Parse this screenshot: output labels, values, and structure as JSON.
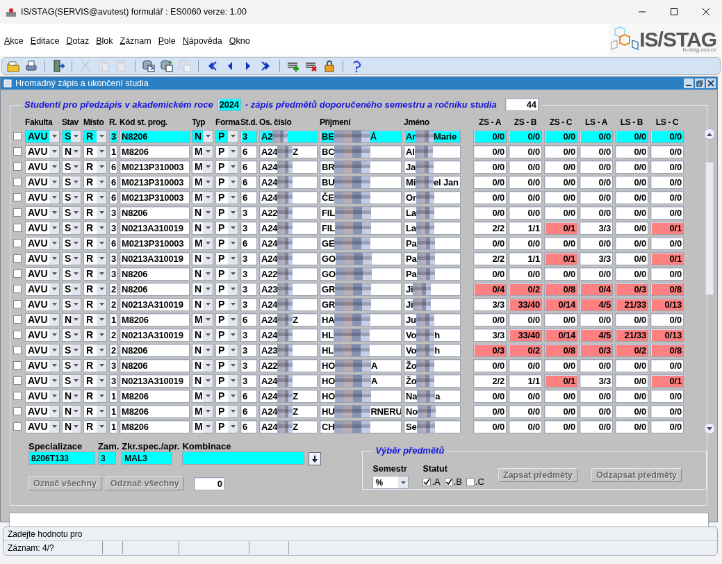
{
  "window": {
    "title": "IS/STAG(SERVIS@avutest) formulář : ES0060 verze: 1.00"
  },
  "menu": [
    "Akce",
    "Editace",
    "Dotaz",
    "Blok",
    "Záznam",
    "Pole",
    "Nápověda",
    "Okno"
  ],
  "logo": {
    "name": "IS/STAG",
    "url": "is-stag.zcu.cz"
  },
  "toolbar": [
    {
      "kind": "save",
      "disabled": false
    },
    {
      "kind": "print",
      "disabled": false
    },
    {
      "kind": "sep"
    },
    {
      "kind": "exit",
      "disabled": false
    },
    {
      "kind": "sep"
    },
    {
      "kind": "cut",
      "disabled": true
    },
    {
      "kind": "copy",
      "disabled": true
    },
    {
      "kind": "paste",
      "disabled": true
    },
    {
      "kind": "sep"
    },
    {
      "kind": "query",
      "disabled": false
    },
    {
      "kind": "query-run",
      "disabled": false
    },
    {
      "kind": "query-cancel",
      "disabled": true
    },
    {
      "kind": "sep"
    },
    {
      "kind": "first",
      "disabled": false
    },
    {
      "kind": "prev",
      "disabled": false
    },
    {
      "kind": "next",
      "disabled": false
    },
    {
      "kind": "last",
      "disabled": false
    },
    {
      "kind": "sep"
    },
    {
      "kind": "insert",
      "disabled": false
    },
    {
      "kind": "delete",
      "disabled": false
    },
    {
      "kind": "lock",
      "disabled": false
    },
    {
      "kind": "sep"
    },
    {
      "kind": "help",
      "disabled": false
    }
  ],
  "form": {
    "title": "Hromadný zápis a ukončení studia"
  },
  "header": {
    "lead": "Studenti pro předzápis v akademickém roce",
    "year": "2024",
    "trail": "- zápis předmětů doporučeného semestru a ročníku studia",
    "count": "44"
  },
  "table": {
    "columns": [
      "Fakulta",
      "Stav",
      "Místo",
      "R.",
      "Kód st. prog.",
      "Typ",
      "Forma",
      "St.d.",
      "Os. číslo",
      "Příjmení",
      "Jméno"
    ],
    "score_columns": [
      "ZS - A",
      "ZS - B",
      "ZS - C",
      "LS - A",
      "LS - B",
      "LS - C"
    ],
    "rows": [
      {
        "selected": true,
        "checked": false,
        "fakulta": "AVU",
        "stav": "S",
        "misto": "R",
        "r": "3",
        "kod": "N8206",
        "typ": "N",
        "forma": "P",
        "std": "3",
        "osc": "A2",
        "prijmeni": "BE",
        "prijmeni_end": "Á",
        "jmeno": "Ar",
        "jmeno_end": "Marie",
        "scores": [
          {
            "text": "0/0",
            "alert": false
          },
          {
            "text": "0/0",
            "alert": false
          },
          {
            "text": "0/0",
            "alert": false
          },
          {
            "text": "0/0",
            "alert": false
          },
          {
            "text": "0/0",
            "alert": false
          },
          {
            "text": "0/0",
            "alert": false
          }
        ]
      },
      {
        "selected": false,
        "checked": false,
        "fakulta": "AVU",
        "stav": "N",
        "misto": "R",
        "r": "1",
        "kod": "M8206",
        "typ": "M",
        "forma": "P",
        "std": "6",
        "osc": "A24",
        "osc_end": "Z",
        "prijmeni": "BC",
        "jmeno": "Al",
        "scores": [
          {
            "text": "0/0",
            "alert": false
          },
          {
            "text": "0/0",
            "alert": false
          },
          {
            "text": "0/0",
            "alert": false
          },
          {
            "text": "0/0",
            "alert": false
          },
          {
            "text": "0/0",
            "alert": false
          },
          {
            "text": "0/0",
            "alert": false
          }
        ]
      },
      {
        "selected": false,
        "checked": false,
        "fakulta": "AVU",
        "stav": "S",
        "misto": "R",
        "r": "6",
        "kod": "M0213P310003",
        "typ": "M",
        "forma": "P",
        "std": "6",
        "osc": "A24",
        "prijmeni": "BR",
        "jmeno": "Ja",
        "scores": [
          {
            "text": "0/0",
            "alert": false
          },
          {
            "text": "0/0",
            "alert": false
          },
          {
            "text": "0/0",
            "alert": false
          },
          {
            "text": "0/0",
            "alert": false
          },
          {
            "text": "0/0",
            "alert": false
          },
          {
            "text": "0/0",
            "alert": false
          }
        ]
      },
      {
        "selected": false,
        "checked": false,
        "fakulta": "AVU",
        "stav": "S",
        "misto": "R",
        "r": "6",
        "kod": "M0213P310003",
        "typ": "M",
        "forma": "P",
        "std": "6",
        "osc": "A24",
        "prijmeni": "BU",
        "jmeno": "Mi",
        "jmeno_end": "el Jan",
        "scores": [
          {
            "text": "0/0",
            "alert": false
          },
          {
            "text": "0/0",
            "alert": false
          },
          {
            "text": "0/0",
            "alert": false
          },
          {
            "text": "0/0",
            "alert": false
          },
          {
            "text": "0/0",
            "alert": false
          },
          {
            "text": "0/0",
            "alert": false
          }
        ]
      },
      {
        "selected": false,
        "checked": false,
        "fakulta": "AVU",
        "stav": "S",
        "misto": "R",
        "r": "6",
        "kod": "M0213P310003",
        "typ": "M",
        "forma": "P",
        "std": "6",
        "osc": "A24",
        "prijmeni": "ČE",
        "jmeno": "Or",
        "scores": [
          {
            "text": "0/0",
            "alert": false
          },
          {
            "text": "0/0",
            "alert": false
          },
          {
            "text": "0/0",
            "alert": false
          },
          {
            "text": "0/0",
            "alert": false
          },
          {
            "text": "0/0",
            "alert": false
          },
          {
            "text": "0/0",
            "alert": false
          }
        ]
      },
      {
        "selected": false,
        "checked": false,
        "fakulta": "AVU",
        "stav": "S",
        "misto": "R",
        "r": "3",
        "kod": "N8206",
        "typ": "N",
        "forma": "P",
        "std": "3",
        "osc": "A22",
        "prijmeni": "FIL",
        "jmeno": "La",
        "scores": [
          {
            "text": "0/0",
            "alert": false
          },
          {
            "text": "0/0",
            "alert": false
          },
          {
            "text": "0/0",
            "alert": false
          },
          {
            "text": "0/0",
            "alert": false
          },
          {
            "text": "0/0",
            "alert": false
          },
          {
            "text": "0/0",
            "alert": false
          }
        ]
      },
      {
        "selected": false,
        "checked": false,
        "fakulta": "AVU",
        "stav": "S",
        "misto": "R",
        "r": "3",
        "kod": "N0213A310019",
        "typ": "N",
        "forma": "P",
        "std": "3",
        "osc": "A24",
        "prijmeni": "FIL",
        "jmeno": "La",
        "scores": [
          {
            "text": "2/2",
            "alert": false
          },
          {
            "text": "1/1",
            "alert": false
          },
          {
            "text": "0/1",
            "alert": true
          },
          {
            "text": "3/3",
            "alert": false
          },
          {
            "text": "0/0",
            "alert": false
          },
          {
            "text": "0/1",
            "alert": true
          }
        ]
      },
      {
        "selected": false,
        "checked": false,
        "fakulta": "AVU",
        "stav": "S",
        "misto": "R",
        "r": "6",
        "kod": "M0213P310003",
        "typ": "M",
        "forma": "P",
        "std": "6",
        "osc": "A24",
        "prijmeni": "GE",
        "jmeno": "Pa",
        "scores": [
          {
            "text": "0/0",
            "alert": false
          },
          {
            "text": "0/0",
            "alert": false
          },
          {
            "text": "0/0",
            "alert": false
          },
          {
            "text": "0/0",
            "alert": false
          },
          {
            "text": "0/0",
            "alert": false
          },
          {
            "text": "0/0",
            "alert": false
          }
        ]
      },
      {
        "selected": false,
        "checked": false,
        "fakulta": "AVU",
        "stav": "S",
        "misto": "R",
        "r": "3",
        "kod": "N0213A310019",
        "typ": "N",
        "forma": "P",
        "std": "3",
        "osc": "A24",
        "prijmeni": "GO",
        "jmeno": "Pa",
        "scores": [
          {
            "text": "2/2",
            "alert": false
          },
          {
            "text": "1/1",
            "alert": false
          },
          {
            "text": "0/1",
            "alert": true
          },
          {
            "text": "3/3",
            "alert": false
          },
          {
            "text": "0/0",
            "alert": false
          },
          {
            "text": "0/1",
            "alert": true
          }
        ]
      },
      {
        "selected": false,
        "checked": false,
        "fakulta": "AVU",
        "stav": "S",
        "misto": "R",
        "r": "3",
        "kod": "N8206",
        "typ": "N",
        "forma": "P",
        "std": "3",
        "osc": "A22",
        "prijmeni": "GO",
        "jmeno": "Pa",
        "scores": [
          {
            "text": "0/0",
            "alert": false
          },
          {
            "text": "0/0",
            "alert": false
          },
          {
            "text": "0/0",
            "alert": false
          },
          {
            "text": "0/0",
            "alert": false
          },
          {
            "text": "0/0",
            "alert": false
          },
          {
            "text": "0/0",
            "alert": false
          }
        ]
      },
      {
        "selected": false,
        "checked": false,
        "fakulta": "AVU",
        "stav": "S",
        "misto": "R",
        "r": "2",
        "kod": "N8206",
        "typ": "N",
        "forma": "P",
        "std": "3",
        "osc": "A23",
        "prijmeni": "GR",
        "jmeno": "Ji",
        "scores": [
          {
            "text": "0/4",
            "alert": true
          },
          {
            "text": "0/2",
            "alert": true
          },
          {
            "text": "0/8",
            "alert": true
          },
          {
            "text": "0/4",
            "alert": true
          },
          {
            "text": "0/3",
            "alert": true
          },
          {
            "text": "0/8",
            "alert": true
          }
        ]
      },
      {
        "selected": false,
        "checked": false,
        "fakulta": "AVU",
        "stav": "S",
        "misto": "R",
        "r": "2",
        "kod": "N0213A310019",
        "typ": "N",
        "forma": "P",
        "std": "3",
        "osc": "A24",
        "prijmeni": "GR",
        "jmeno": "Ji",
        "scores": [
          {
            "text": "3/3",
            "alert": false
          },
          {
            "text": "33/40",
            "alert": true
          },
          {
            "text": "0/14",
            "alert": true
          },
          {
            "text": "4/5",
            "alert": true
          },
          {
            "text": "21/33",
            "alert": true
          },
          {
            "text": "0/13",
            "alert": true
          }
        ]
      },
      {
        "selected": false,
        "checked": false,
        "fakulta": "AVU",
        "stav": "N",
        "misto": "R",
        "r": "1",
        "kod": "M8206",
        "typ": "M",
        "forma": "P",
        "std": "6",
        "osc": "A24",
        "osc_end": "Z",
        "prijmeni": "HA",
        "jmeno": "Ju",
        "scores": [
          {
            "text": "0/0",
            "alert": false
          },
          {
            "text": "0/0",
            "alert": false
          },
          {
            "text": "0/0",
            "alert": false
          },
          {
            "text": "0/0",
            "alert": false
          },
          {
            "text": "0/0",
            "alert": false
          },
          {
            "text": "0/0",
            "alert": false
          }
        ]
      },
      {
        "selected": false,
        "checked": false,
        "fakulta": "AVU",
        "stav": "S",
        "misto": "R",
        "r": "2",
        "kod": "N0213A310019",
        "typ": "N",
        "forma": "P",
        "std": "3",
        "osc": "A24",
        "prijmeni": "HL",
        "jmeno": "Vo",
        "jmeno_end": "h",
        "scores": [
          {
            "text": "3/3",
            "alert": false
          },
          {
            "text": "33/40",
            "alert": true
          },
          {
            "text": "0/14",
            "alert": true
          },
          {
            "text": "4/5",
            "alert": true
          },
          {
            "text": "21/33",
            "alert": true
          },
          {
            "text": "0/13",
            "alert": true
          }
        ]
      },
      {
        "selected": false,
        "checked": false,
        "fakulta": "AVU",
        "stav": "S",
        "misto": "R",
        "r": "2",
        "kod": "N8206",
        "typ": "N",
        "forma": "P",
        "std": "3",
        "osc": "A23",
        "prijmeni": "HL",
        "jmeno": "Vo",
        "jmeno_end": "h",
        "scores": [
          {
            "text": "0/3",
            "alert": true
          },
          {
            "text": "0/2",
            "alert": true
          },
          {
            "text": "0/8",
            "alert": true
          },
          {
            "text": "0/3",
            "alert": true
          },
          {
            "text": "0/2",
            "alert": true
          },
          {
            "text": "0/8",
            "alert": true
          }
        ]
      },
      {
        "selected": false,
        "checked": false,
        "fakulta": "AVU",
        "stav": "S",
        "misto": "R",
        "r": "3",
        "kod": "N8206",
        "typ": "N",
        "forma": "P",
        "std": "3",
        "osc": "A22",
        "prijmeni": "HO",
        "prijmeni_end": "A",
        "jmeno": "Žo",
        "scores": [
          {
            "text": "0/0",
            "alert": false
          },
          {
            "text": "0/0",
            "alert": false
          },
          {
            "text": "0/0",
            "alert": false
          },
          {
            "text": "0/0",
            "alert": false
          },
          {
            "text": "0/0",
            "alert": false
          },
          {
            "text": "0/0",
            "alert": false
          }
        ]
      },
      {
        "selected": false,
        "checked": false,
        "fakulta": "AVU",
        "stav": "S",
        "misto": "R",
        "r": "3",
        "kod": "N0213A310019",
        "typ": "N",
        "forma": "P",
        "std": "3",
        "osc": "A24",
        "prijmeni": "HO",
        "prijmeni_end": "A",
        "jmeno": "Žo",
        "scores": [
          {
            "text": "2/2",
            "alert": false
          },
          {
            "text": "1/1",
            "alert": false
          },
          {
            "text": "0/1",
            "alert": true
          },
          {
            "text": "3/3",
            "alert": false
          },
          {
            "text": "0/0",
            "alert": false
          },
          {
            "text": "0/1",
            "alert": true
          }
        ]
      },
      {
        "selected": false,
        "checked": false,
        "fakulta": "AVU",
        "stav": "N",
        "misto": "R",
        "r": "1",
        "kod": "M8206",
        "typ": "M",
        "forma": "P",
        "std": "6",
        "osc": "A24",
        "osc_end": "Z",
        "prijmeni": "HO",
        "jmeno": "Na",
        "jmeno_end": "a",
        "scores": [
          {
            "text": "0/0",
            "alert": false
          },
          {
            "text": "0/0",
            "alert": false
          },
          {
            "text": "0/0",
            "alert": false
          },
          {
            "text": "0/0",
            "alert": false
          },
          {
            "text": "0/0",
            "alert": false
          },
          {
            "text": "0/0",
            "alert": false
          }
        ]
      },
      {
        "selected": false,
        "checked": false,
        "fakulta": "AVU",
        "stav": "N",
        "misto": "R",
        "r": "1",
        "kod": "M8206",
        "typ": "M",
        "forma": "P",
        "std": "6",
        "osc": "A24",
        "osc_end": "Z",
        "prijmeni": "HU",
        "prijmeni_end": "RNERU",
        "jmeno": "No",
        "scores": [
          {
            "text": "0/0",
            "alert": false
          },
          {
            "text": "0/0",
            "alert": false
          },
          {
            "text": "0/0",
            "alert": false
          },
          {
            "text": "0/0",
            "alert": false
          },
          {
            "text": "0/0",
            "alert": false
          },
          {
            "text": "0/0",
            "alert": false
          }
        ]
      },
      {
        "selected": false,
        "checked": false,
        "fakulta": "AVU",
        "stav": "N",
        "misto": "R",
        "r": "1",
        "kod": "M8206",
        "typ": "M",
        "forma": "P",
        "std": "6",
        "osc": "A24",
        "osc_end": "Z",
        "prijmeni": "CH",
        "jmeno": "Se",
        "scores": [
          {
            "text": "0/0",
            "alert": false
          },
          {
            "text": "0/0",
            "alert": false
          },
          {
            "text": "0/0",
            "alert": false
          },
          {
            "text": "0/0",
            "alert": false
          },
          {
            "text": "0/0",
            "alert": false
          },
          {
            "text": "0/0",
            "alert": false
          }
        ]
      }
    ]
  },
  "detail": {
    "fields": [
      {
        "label": "Specializace",
        "value": "8206T133"
      },
      {
        "label": "Zam.",
        "value": "3"
      },
      {
        "label": "Zkr.spec./apr.",
        "value": "MAL3"
      },
      {
        "label": "Kombinace"
      }
    ],
    "buttons": [
      {
        "label": "Označ všechny",
        "disabled": true
      },
      {
        "label": "Odznač všechny",
        "disabled": true
      }
    ],
    "selected_count": "0"
  },
  "subject_selection": {
    "title": "Výběr předmětů",
    "semestr_label": "Semestr",
    "semestr": "%",
    "statut_label": "Statut",
    "statuses": [
      {
        "label": ".A",
        "checked": true
      },
      {
        "label": ".B",
        "checked": true
      },
      {
        "label": ".C",
        "checked": false
      }
    ],
    "buttons": [
      {
        "label": "Zapsat předměty",
        "disabled": true
      },
      {
        "label": "Odzapsat předměty",
        "disabled": true
      }
    ]
  },
  "status_bar": {
    "message": "Zadejte hodnotu pro",
    "record": "Záznam: 4/?"
  }
}
